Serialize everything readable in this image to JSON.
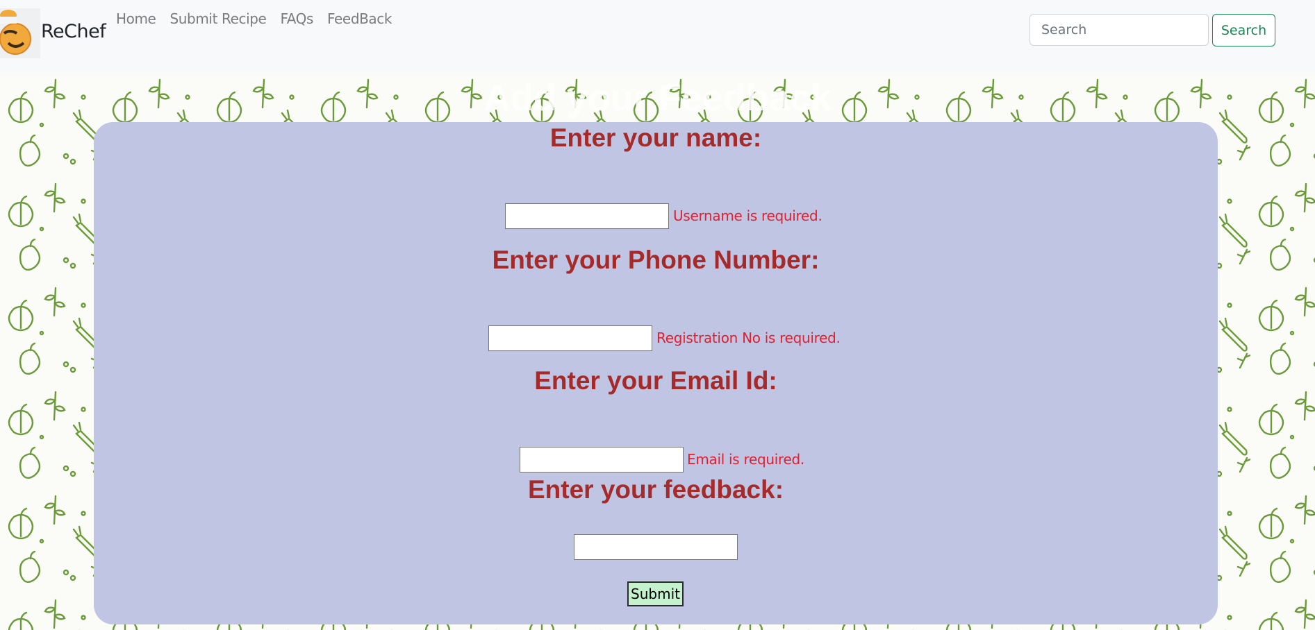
{
  "navbar": {
    "brand": "ReChef",
    "links": [
      "Home",
      "Submit Recipe",
      "FAQs",
      "FeedBack"
    ],
    "search_placeholder": "Search",
    "search_button": "Search"
  },
  "page": {
    "heading": "Add your Feedback"
  },
  "form": {
    "name_label": "Enter your name:",
    "name_error": "Username is required.",
    "phone_label": "Enter your Phone Number:",
    "phone_error": "Registration No is required.",
    "email_label": "Enter your Email Id:",
    "email_error": "Email is required.",
    "feedback_label": "Enter your feedback:",
    "submit_label": "Submit"
  },
  "icons": {
    "logo": "chef-emoji-logo",
    "pattern": "vegetable-doodle-pattern"
  },
  "colors": {
    "label_text": "#a52a2a",
    "error_text": "#e0202f",
    "card_bg": "#c0c5e3",
    "pattern_stroke": "#6b9a3a",
    "search_button": "#198754",
    "submit_bg": "#c3f2cd"
  }
}
